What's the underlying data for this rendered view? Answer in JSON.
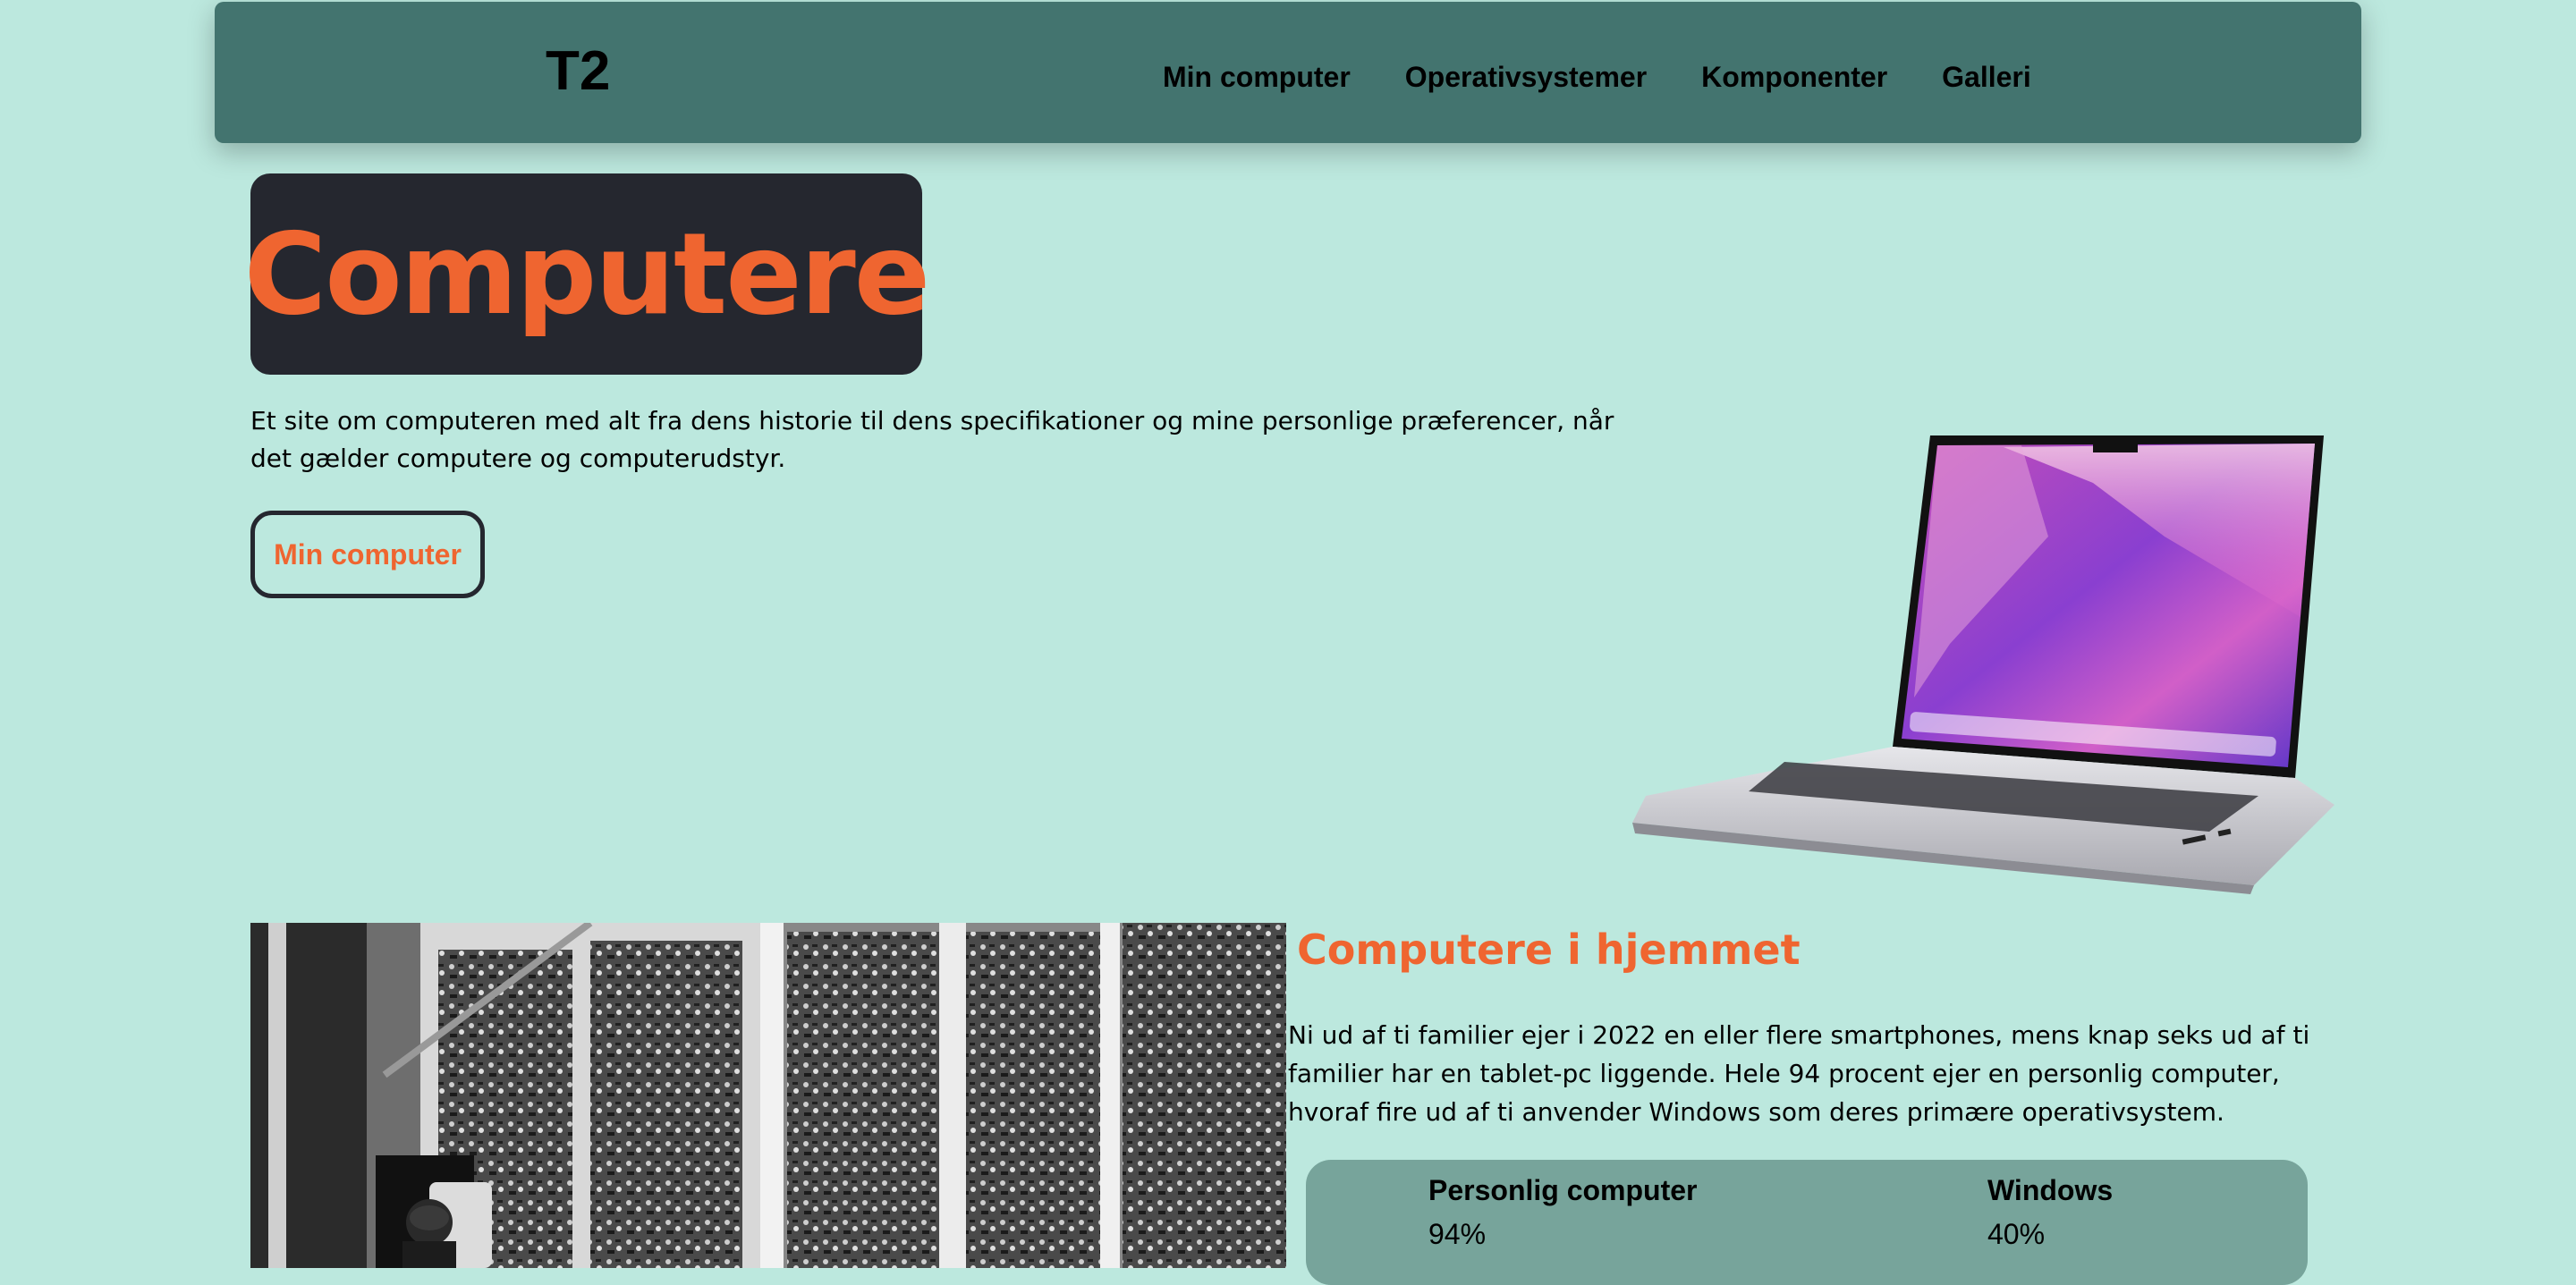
{
  "header": {
    "logo": "T2",
    "nav": [
      "Min computer",
      "Operativsystemer",
      "Komponenter",
      "Galleri"
    ]
  },
  "hero": {
    "title": "Computere",
    "description": "Et site om computeren med alt fra dens historie til dens specifikationer og mine personlige præferencer, når det gælder computere og computerudstyr.",
    "button_label": "Min computer"
  },
  "section": {
    "title": "Computere i hjemmet",
    "text": "Ni ud af ti familier ejer i 2022 en eller flere smartphones, mens knap seks ud af ti familier har en tablet-pc liggende. Hele 94 procent ejer en personlig computer, hvoraf fire ud af ti anvender Windows som deres primære operativsystem.",
    "stats": [
      {
        "label": "Personlig computer",
        "value": "94%"
      },
      {
        "label": "Windows",
        "value": "40%"
      }
    ]
  },
  "colors": {
    "background": "#bce8de",
    "navbar": "#43746f",
    "accent": "#ef6530",
    "dark": "#25272f",
    "stats_box": "#77a49b"
  }
}
